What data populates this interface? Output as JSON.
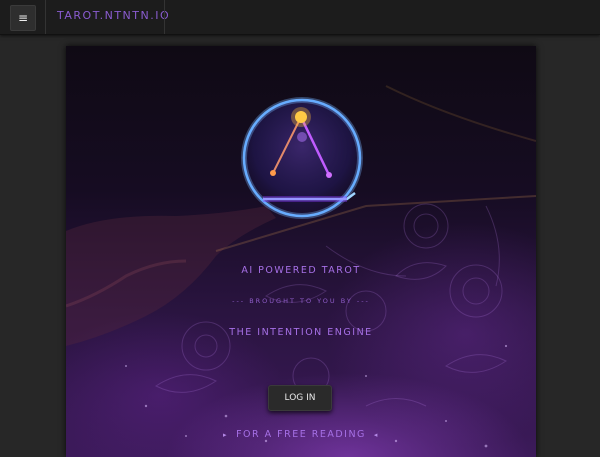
{
  "topbar": {
    "menu_icon": "hamburger-icon",
    "menu_glyph": "≡",
    "brand": "TAROT.NTNTN.IO"
  },
  "hero": {
    "logo_icon": "triangle-orb-logo",
    "title": "AI POWERED TAROT",
    "brought_by": "--- BROUGHT TO YOU BY ---",
    "engine": "THE INTENTION ENGINE"
  },
  "actions": {
    "login_label": "LOG IN",
    "free_reading": "FOR A FREE READING",
    "arrow_right_glyph": "▸",
    "arrow_left_glyph": "◂"
  },
  "colors": {
    "accent": "#a670e6",
    "background": "#272727",
    "topbar": "#1c1c1c"
  }
}
